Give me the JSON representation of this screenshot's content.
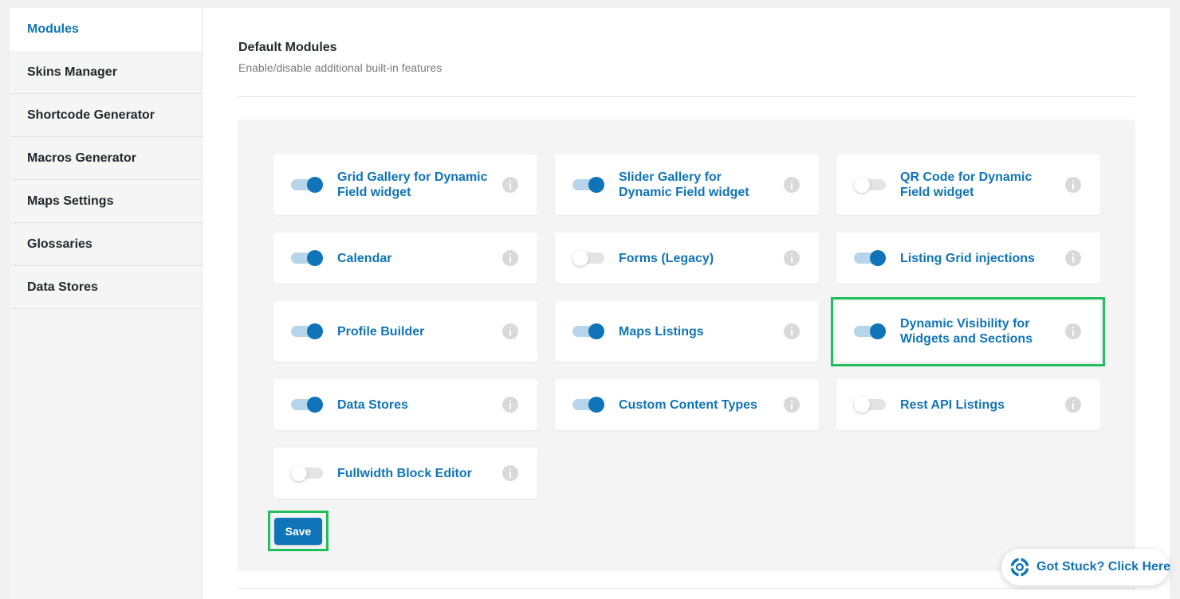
{
  "sidebar": {
    "items": [
      {
        "label": "Modules",
        "active": true
      },
      {
        "label": "Skins Manager"
      },
      {
        "label": "Shortcode Generator"
      },
      {
        "label": "Macros Generator"
      },
      {
        "label": "Maps Settings"
      },
      {
        "label": "Glossaries"
      },
      {
        "label": "Data Stores"
      }
    ]
  },
  "section": {
    "title": "Default Modules",
    "description": "Enable/disable additional built-in features"
  },
  "modules": [
    {
      "label": "Grid Gallery for Dynamic Field widget",
      "enabled": true
    },
    {
      "label": "Slider Gallery for Dynamic Field widget",
      "enabled": true
    },
    {
      "label": "QR Code for Dynamic Field widget",
      "enabled": false
    },
    {
      "label": "Calendar",
      "enabled": true
    },
    {
      "label": "Forms (Legacy)",
      "enabled": false
    },
    {
      "label": "Listing Grid injections",
      "enabled": true
    },
    {
      "label": "Profile Builder",
      "enabled": true
    },
    {
      "label": "Maps Listings",
      "enabled": true
    },
    {
      "label": "Dynamic Visibility for Widgets and Sections",
      "enabled": true,
      "highlighted": true
    },
    {
      "label": "Data Stores",
      "enabled": true
    },
    {
      "label": "Custom Content Types",
      "enabled": true
    },
    {
      "label": "Rest API Listings",
      "enabled": false
    },
    {
      "label": "Fullwidth Block Editor",
      "enabled": false
    }
  ],
  "actions": {
    "save_label": "Save",
    "save_highlighted": true
  },
  "help": {
    "label": "Got Stuck? Click Here",
    "icon": "lifebuoy-icon"
  },
  "colors": {
    "accent": "#0f74b8",
    "toggle_track_on": "#b6d5ea",
    "toggle_track_off": "#e4e4e4",
    "highlight": "#1fbf5b",
    "info_icon": "#d9d9d9"
  }
}
